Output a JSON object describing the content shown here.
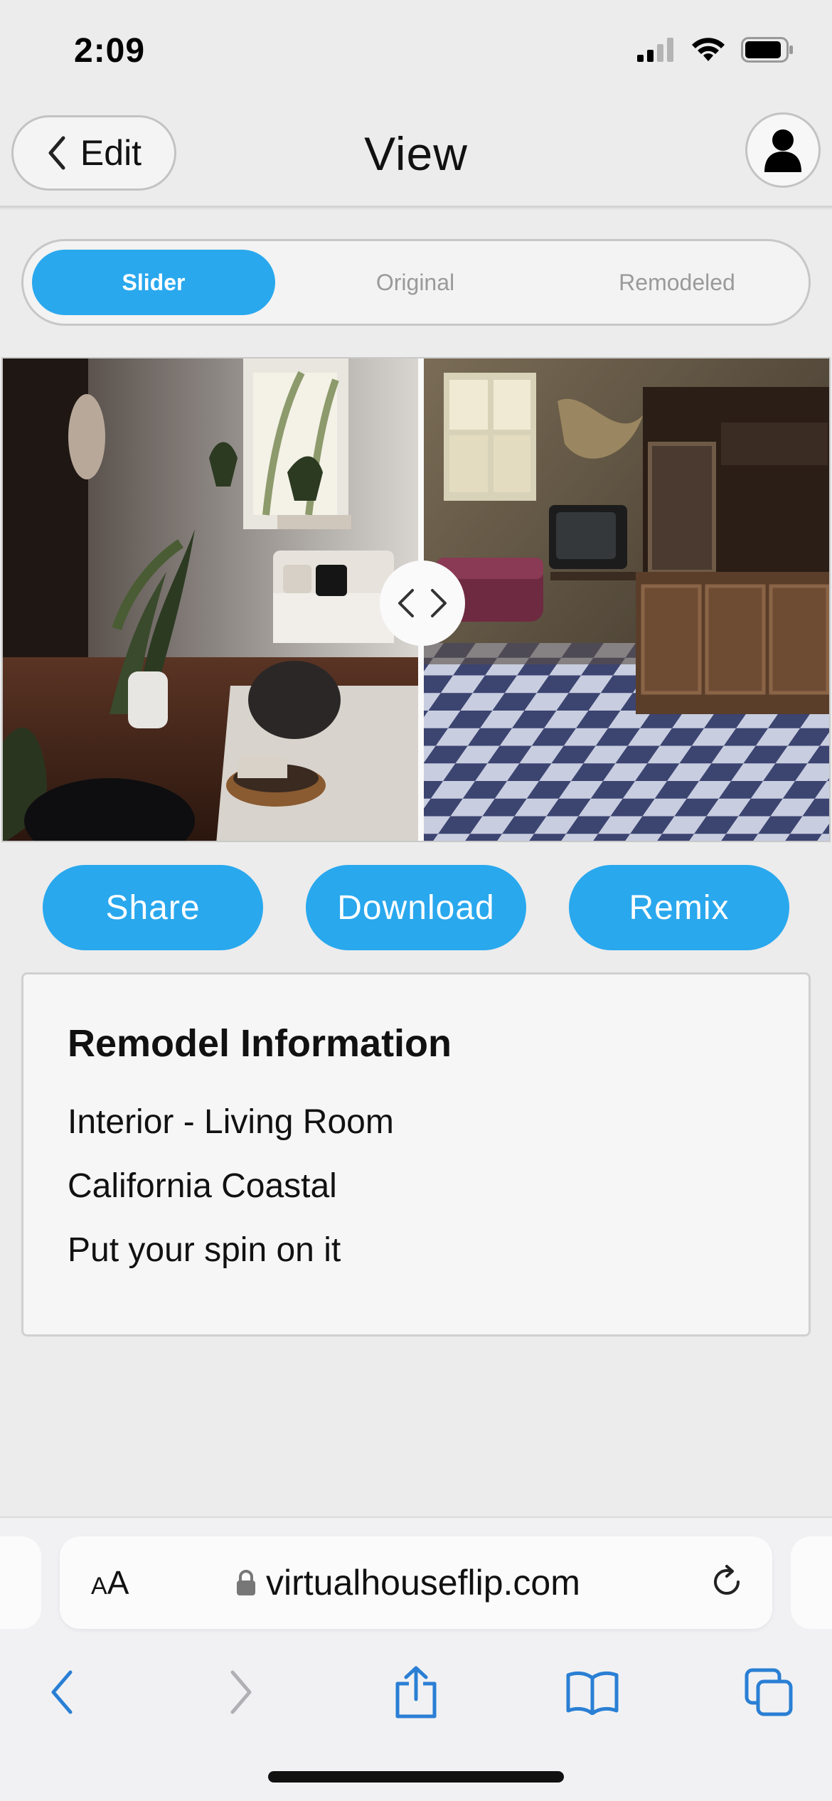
{
  "status_bar": {
    "time": "2:09"
  },
  "header": {
    "back_label": "Edit",
    "title": "View"
  },
  "segments": [
    {
      "label": "Slider",
      "active": true
    },
    {
      "label": "Original",
      "active": false
    },
    {
      "label": "Remodeled",
      "active": false
    }
  ],
  "actions": {
    "share": "Share",
    "download": "Download",
    "remix": "Remix"
  },
  "info": {
    "title": "Remodel Information",
    "lines": [
      "Interior - Living Room",
      "California Coastal",
      "Put your spin on it"
    ]
  },
  "browser": {
    "aa_big": "A",
    "aa_small": "A",
    "url": "virtualhouseflip.com"
  },
  "colors": {
    "accent": "#29a8ee",
    "background": "#ececec",
    "card": "#f6f6f6"
  },
  "icons": [
    "chevron-left-icon",
    "user-icon",
    "chevron-left-right-icon",
    "lock-icon",
    "reload-icon",
    "share-icon",
    "book-icon",
    "tabs-icon",
    "cellular-icon",
    "wifi-icon",
    "battery-icon"
  ]
}
